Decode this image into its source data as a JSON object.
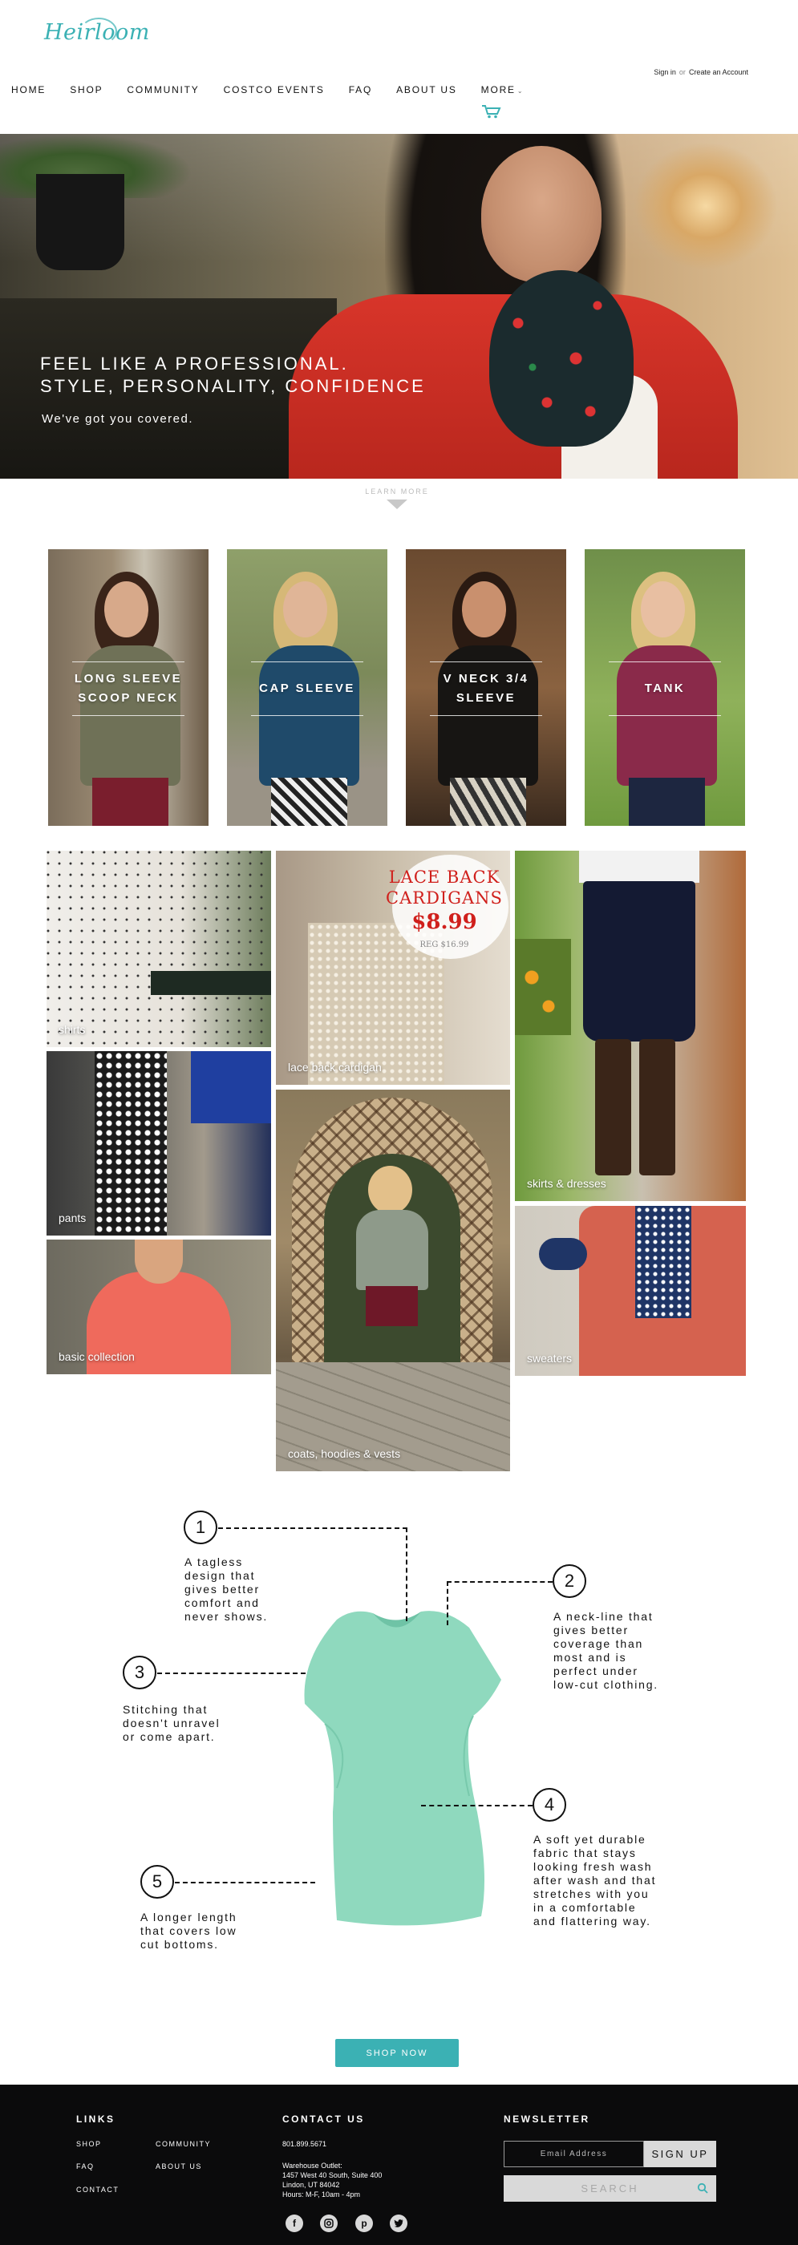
{
  "header": {
    "logo_text": "Heirloom",
    "sign_in": "Sign in",
    "or": "or",
    "create_account": "Create an Account",
    "nav": [
      "HOME",
      "SHOP",
      "COMMUNITY",
      "COSTCO EVENTS",
      "FAQ",
      "ABOUT US",
      "MORE"
    ]
  },
  "hero": {
    "line1": "FEEL LIKE A PROFESSIONAL.",
    "line2": "STYLE, PERSONALITY, CONFIDENCE",
    "sub": "We've got you covered.",
    "learn_more": "LEARN MORE"
  },
  "styles": [
    {
      "label": "LONG SLEEVE\nSCOOP NECK"
    },
    {
      "label": "CAP SLEEVE"
    },
    {
      "label": "V NECK 3/4\nSLEEVE"
    },
    {
      "label": "TANK"
    }
  ],
  "collection": {
    "shirts": "shirts",
    "pants": "pants",
    "basic": "basic collection",
    "lace": "lace back cardigan",
    "coats": "coats, hoodies & vests",
    "skirts": "skirts & dresses",
    "sweaters": "sweaters",
    "promo": {
      "title": "LACE BACK CARDIGANS",
      "price": "$8.99",
      "reg": "REG $16.99"
    }
  },
  "features": [
    {
      "num": "1",
      "text": "A tagless\ndesign that\ngives better\ncomfort and\nnever shows."
    },
    {
      "num": "2",
      "text": "A neck-line that\ngives better\ncoverage than\nmost and is\nperfect under\nlow-cut clothing."
    },
    {
      "num": "3",
      "text": "Stitching that\ndoesn't unravel\nor come apart."
    },
    {
      "num": "4",
      "text": "A soft yet durable\nfabric that stays\nlooking fresh wash\nafter wash and that\nstretches with you\nin a comfortable\nand flattering way."
    },
    {
      "num": "5",
      "text": "A longer length\nthat covers low\ncut bottoms."
    }
  ],
  "shop_now": "SHOP NOW",
  "footer": {
    "links_heading": "LINKS",
    "links": [
      "SHOP",
      "COMMUNITY",
      "FAQ",
      "ABOUT US",
      "CONTACT"
    ],
    "contact_heading": "CONTACT US",
    "phone": "801.899.5671",
    "address": [
      "Warehouse Outlet:",
      "1457 West 40 South, Suite 400",
      "Lindon, UT 84042",
      "Hours: M-F, 10am - 4pm"
    ],
    "newsletter_heading": "NEWSLETTER",
    "email_placeholder": "Email Address",
    "sign_up": "SIGN UP",
    "search_placeholder": "SEARCH",
    "social": [
      "facebook-icon",
      "instagram-icon",
      "pinterest-icon",
      "twitter-icon"
    ]
  },
  "colors": {
    "accent": "#3bb1b4",
    "promo_red": "#d0201c",
    "footer_bg": "#0b0b0c"
  }
}
